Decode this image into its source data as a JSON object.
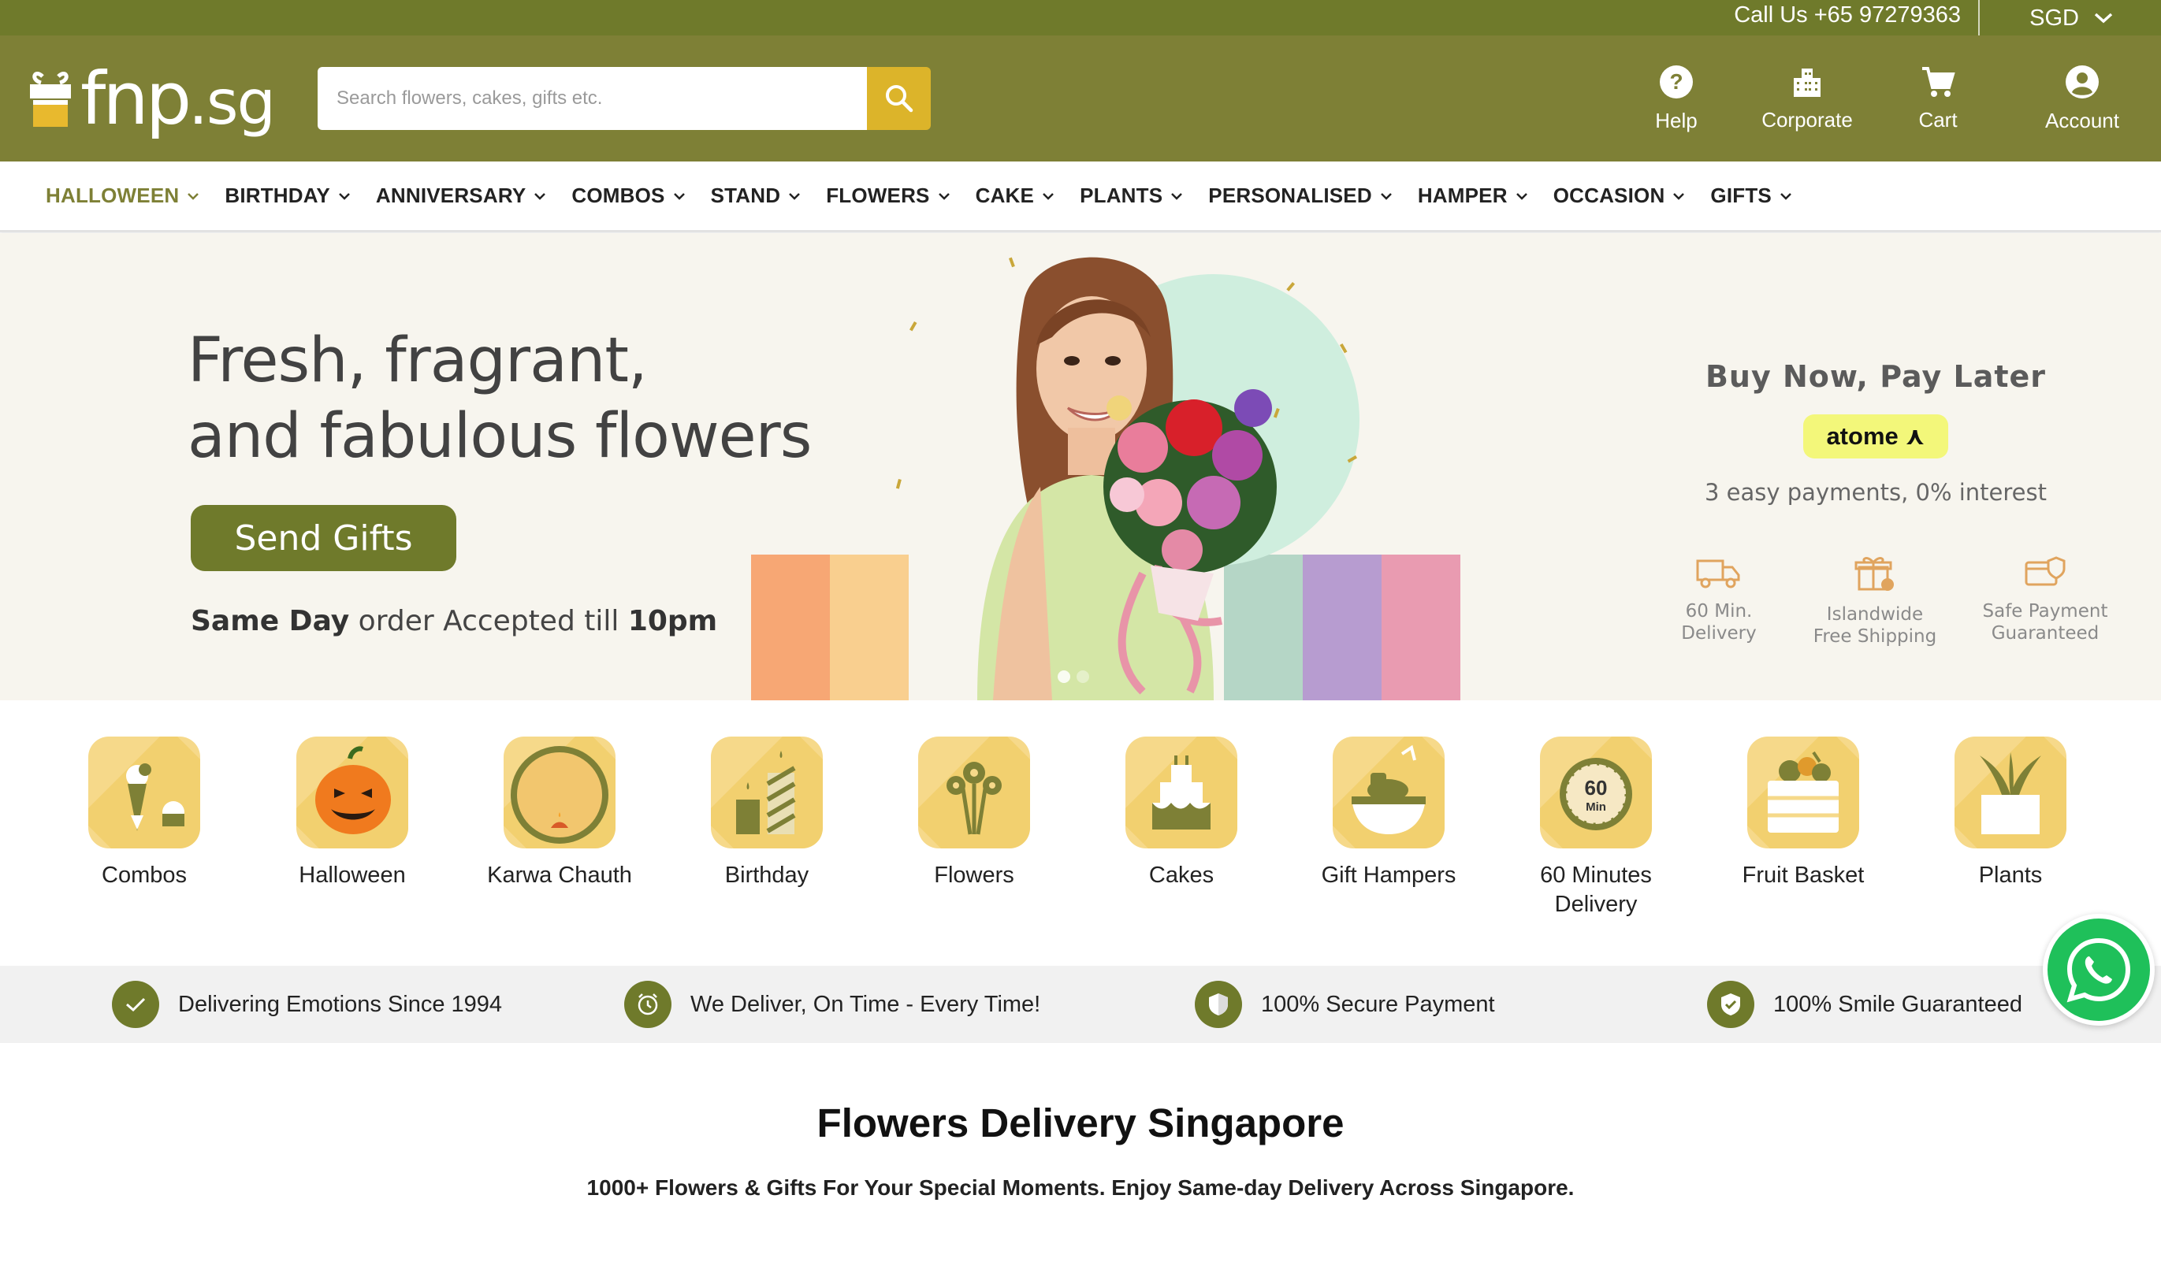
{
  "topbar": {
    "call": "Call Us +65 97279363",
    "currency": "SGD"
  },
  "header": {
    "logo": "fnp",
    "logo_suffix": ".sg",
    "search_placeholder": "Search flowers, cakes, gifts etc.",
    "icons": [
      {
        "label": "Help",
        "icon": "help-icon"
      },
      {
        "label": "Corporate",
        "icon": "building-icon"
      },
      {
        "label": "Cart",
        "icon": "cart-icon"
      },
      {
        "label": "Account",
        "icon": "account-icon"
      }
    ]
  },
  "nav": [
    "HALLOWEEN",
    "BIRTHDAY",
    "ANNIVERSARY",
    "COMBOS",
    "STAND",
    "FLOWERS",
    "CAKE",
    "PLANTS",
    "PERSONALISED",
    "HAMPER",
    "OCCASION",
    "GIFTS"
  ],
  "hero": {
    "headline_1": "Fresh, fragrant,",
    "headline_2": "and fabulous flowers",
    "cta": "Send Gifts",
    "same_day_1": "Same Day",
    "same_day_2": " order Accepted till ",
    "same_day_3": "10pm",
    "bnpl_title": "Buy Now, Pay Later",
    "atome": "atome",
    "bnpl_sub": "3 easy payments, 0% interest",
    "features": [
      {
        "l1": "60 Min.",
        "l2": "Delivery"
      },
      {
        "l1": "Islandwide",
        "l2": "Free Shipping"
      },
      {
        "l1": "Safe Payment",
        "l2": "Guaranteed"
      }
    ],
    "stripe_colors": [
      "#f7a774",
      "#f9cf8f",
      "#f7f5ee",
      "#f7f5ee",
      "#f7f5ee",
      "#f7f5ee",
      "#b5d6c6",
      "#b79cd0",
      "#e99bb1"
    ]
  },
  "categories": [
    {
      "label": "Combos"
    },
    {
      "label": "Halloween"
    },
    {
      "label": "Karwa Chauth"
    },
    {
      "label": "Birthday"
    },
    {
      "label": "Flowers"
    },
    {
      "label": "Cakes"
    },
    {
      "label": "Gift Hampers"
    },
    {
      "label": "60 Minutes",
      "label2": "Delivery"
    },
    {
      "label": "Fruit Basket"
    },
    {
      "label": "Plants"
    }
  ],
  "trust": [
    {
      "text": "Delivering Emotions Since 1994",
      "icon": "check-icon"
    },
    {
      "text": "We Deliver, On Time - Every Time!",
      "icon": "alarm-icon"
    },
    {
      "text": "100% Secure Payment",
      "icon": "shield-icon"
    },
    {
      "text": "100% Smile Guaranteed",
      "icon": "verified-icon"
    }
  ],
  "section": {
    "title": "Flowers Delivery Singapore",
    "subtitle": "1000+ Flowers & Gifts For Your Special Moments. Enjoy Same-day Delivery Across Singapore."
  },
  "colors": {
    "brand": "#7e8036",
    "brand_dark": "#6f7a2b",
    "accent": "#dcb42a",
    "icon_bg": "#f6d98a",
    "whatsapp": "#1fc05a"
  }
}
